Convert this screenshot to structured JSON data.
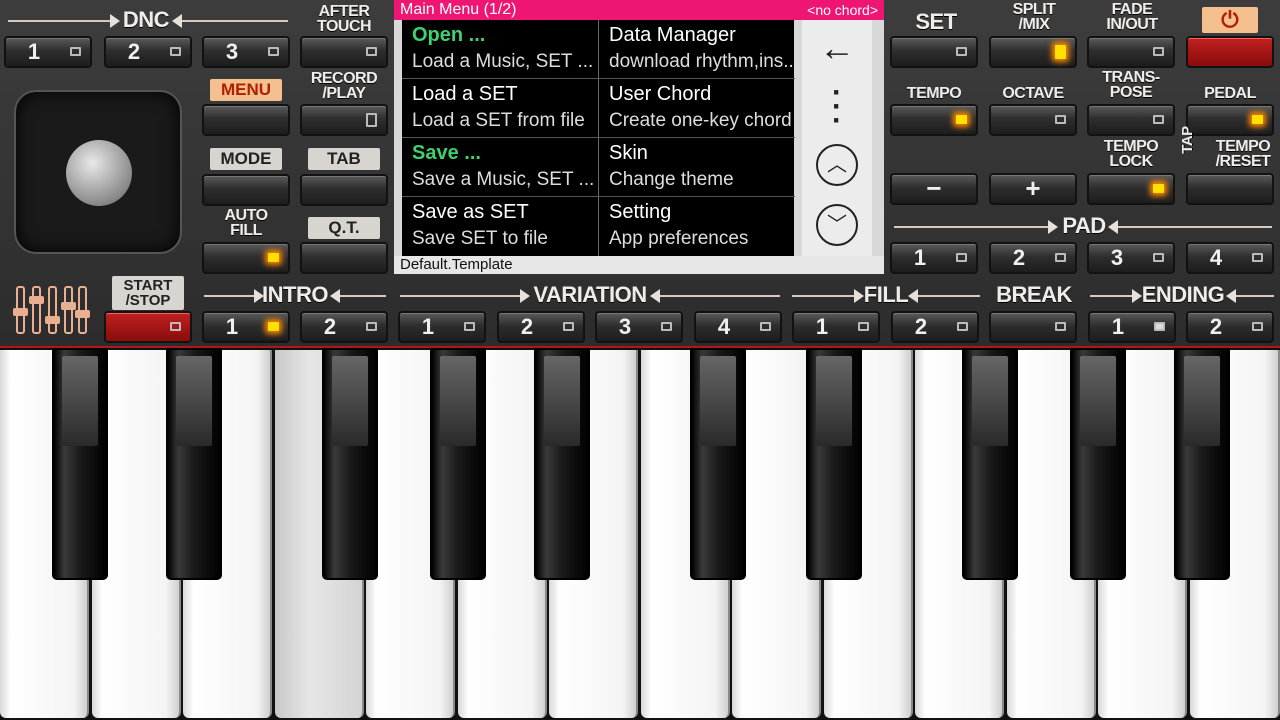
{
  "dnc": {
    "label": "DNC",
    "buttons": [
      "1",
      "2",
      "3"
    ]
  },
  "aftertouch": {
    "label": "AFTER\nTOUCH"
  },
  "menu_label": "MENU",
  "record_label": "RECORD\n/PLAY",
  "mode_label": "MODE",
  "tab_label": "TAB",
  "autofill_label": "AUTO\nFILL",
  "qt_label": "Q.T.",
  "startstop_label": "START\n/STOP",
  "main_menu": {
    "title": "Main Menu (1/2)",
    "chord": "<no chord>",
    "items": [
      {
        "title": "Open ...",
        "sub": "Load a Music, SET ..."
      },
      {
        "title": "Data Manager",
        "sub": "download rhythm,ins..."
      },
      {
        "title": "Load a SET",
        "sub": "Load a SET from file"
      },
      {
        "title": "User Chord",
        "sub": "Create one-key chord"
      },
      {
        "title": "Save ...",
        "sub": "Save a Music, SET ..."
      },
      {
        "title": "Skin",
        "sub": "Change theme"
      },
      {
        "title": "Save as SET",
        "sub": "Save SET to file"
      },
      {
        "title": "Setting",
        "sub": "App preferences"
      }
    ],
    "status": "Default.Template",
    "icons": [
      "back-arrow-icon",
      "more-vert-icon",
      "chevron-up-icon",
      "chevron-down-icon"
    ]
  },
  "right": {
    "set_label": "SET",
    "split_label": "SPLIT\n/MIX",
    "fade_label": "FADE\nIN/OUT",
    "tempo_label": "TEMPO",
    "octave_label": "OCTAVE",
    "transpose_label": "TRANS-\nPOSE",
    "pedal_label": "PEDAL",
    "tempolock_label": "TEMPO\nLOCK",
    "tap_label": "TAP",
    "tempo_reset_label": "TEMPO\n/RESET",
    "minus": "−",
    "plus": "+",
    "pad_label": "PAD",
    "pad_buttons": [
      "1",
      "2",
      "3",
      "4"
    ]
  },
  "sections": {
    "intro": {
      "label": "INTRO",
      "buttons": [
        "1",
        "2"
      ]
    },
    "variation": {
      "label": "VARIATION",
      "buttons": [
        "1",
        "2",
        "3",
        "4"
      ]
    },
    "fill": {
      "label": "FILL",
      "buttons": [
        "1",
        "2"
      ]
    },
    "break": {
      "label": "BREAK"
    },
    "ending": {
      "label": "ENDING",
      "buttons": [
        "1",
        "2"
      ]
    }
  },
  "colors": {
    "accent": "#ee1672",
    "led": "#ffe000",
    "menu_green": "#40d070",
    "red_button": "#a01010"
  }
}
